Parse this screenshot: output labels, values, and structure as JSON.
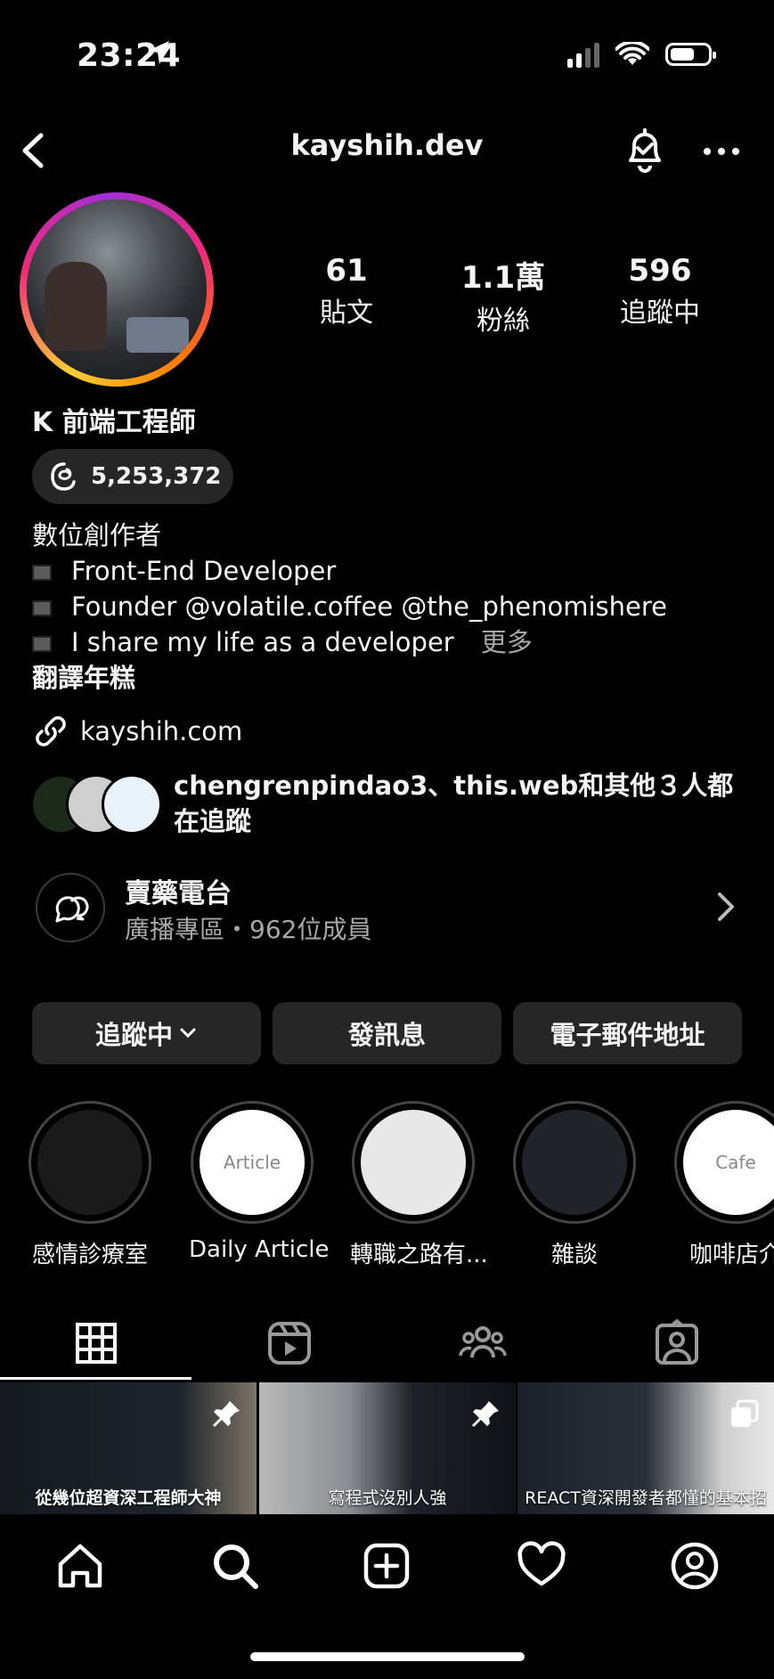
{
  "status": {
    "time": "23:24"
  },
  "header": {
    "username": "kayshih.dev"
  },
  "stats": [
    {
      "value": "61",
      "label": "貼文"
    },
    {
      "value": "1.1萬",
      "label": "粉絲"
    },
    {
      "value": "596",
      "label": "追蹤中"
    }
  ],
  "profile": {
    "name": "K  前端工程師",
    "threads_count": "5,253,372",
    "category": "數位創作者",
    "bio_lines": [
      "Front-End Developer",
      "Founder @volatile.coffee @the_phenomishere",
      "I share my life as a developer"
    ],
    "more": "更多",
    "translate": "翻譯年糕",
    "link": "kayshih.com",
    "mutual": "chengrenpindao3、this.web和其他３人都在追蹤"
  },
  "channel": {
    "title": "賣藥電台",
    "subtitle": "廣播專區・962位成員"
  },
  "buttons": {
    "following": "追蹤中",
    "message": "發訊息",
    "email": "電子郵件地址"
  },
  "highlights": [
    {
      "label": "感情診療室",
      "inner": ""
    },
    {
      "label": "Daily Article",
      "inner": "Article"
    },
    {
      "label": "轉職之路有...",
      "inner": ""
    },
    {
      "label": "雜談",
      "inner": ""
    },
    {
      "label": "咖啡店介",
      "inner": "Cafe"
    }
  ],
  "posts": [
    {
      "caption": "從幾位超資深工程師大神"
    },
    {
      "caption": "寫程式沒別人強"
    },
    {
      "caption": "REACT資深開發者都懂的基本招"
    }
  ],
  "colors": {
    "background": "#000000",
    "button": "#262626",
    "muted": "#a8a8a8"
  }
}
